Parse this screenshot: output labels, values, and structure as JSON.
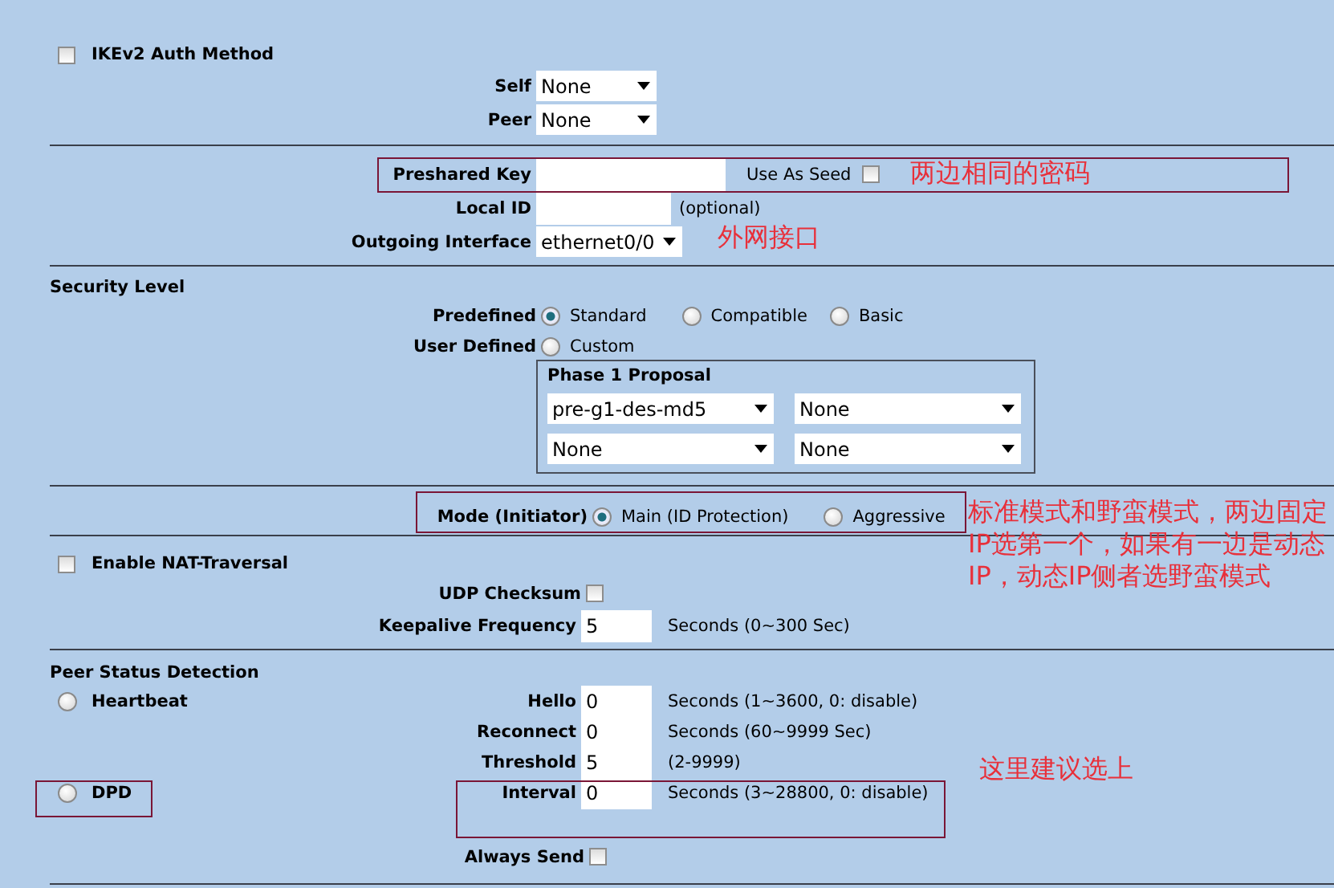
{
  "ike_auth": {
    "label": "IKEv2 Auth Method",
    "checked": false,
    "self": {
      "label": "Self",
      "value": "None"
    },
    "peer": {
      "label": "Peer",
      "value": "None"
    }
  },
  "preshared_key": {
    "label": "Preshared Key",
    "use_as_seed": {
      "label": "Use As Seed",
      "checked": false
    }
  },
  "local_id": {
    "label": "Local ID",
    "hint": "(optional)"
  },
  "outgoing_interface": {
    "label": "Outgoing Interface",
    "value": "ethernet0/0"
  },
  "security_level": {
    "title": "Security Level",
    "predefined": {
      "label": "Predefined",
      "options": [
        {
          "label": "Standard",
          "selected": true
        },
        {
          "label": "Compatible",
          "selected": false
        },
        {
          "label": "Basic",
          "selected": false
        }
      ]
    },
    "user_defined": {
      "label": "User Defined",
      "options": [
        {
          "label": "Custom",
          "selected": false
        }
      ]
    },
    "phase1": {
      "title": "Phase 1 Proposal",
      "values": [
        "pre-g1-des-md5",
        "None",
        "None",
        "None"
      ]
    }
  },
  "mode": {
    "label": "Mode (Initiator)",
    "options": [
      {
        "label": "Main (ID Protection)",
        "selected": true
      },
      {
        "label": "Aggressive",
        "selected": false
      }
    ]
  },
  "nat_traversal": {
    "label": "Enable NAT-Traversal",
    "checked": false,
    "udp_checksum": {
      "label": "UDP Checksum",
      "checked": false
    },
    "keepalive": {
      "label": "Keepalive Frequency",
      "value": "5",
      "hint": "Seconds (0~300 Sec)"
    }
  },
  "peer_status": {
    "title": "Peer Status Detection",
    "methods": [
      {
        "label": "Heartbeat",
        "selected": false
      },
      {
        "label": "DPD",
        "selected": false
      }
    ],
    "fields": [
      {
        "label": "Hello",
        "value": "0",
        "hint": "Seconds (1~3600, 0: disable)"
      },
      {
        "label": "Reconnect",
        "value": "0",
        "hint": "Seconds (60~9999 Sec)"
      },
      {
        "label": "Threshold",
        "value": "5",
        "hint": "(2-9999)"
      },
      {
        "label": "Interval",
        "value": "0",
        "hint": "Seconds (3~28800, 0: disable)"
      }
    ],
    "always_send": {
      "label": "Always Send",
      "checked": false
    }
  },
  "annotations": [
    {
      "text": "两边相同的密码"
    },
    {
      "text": "外网接口"
    },
    {
      "text": "标准模式和野蛮模式，两边固定IP选第一个，如果有一边是动态IP，动态IP侧者选野蛮模式"
    },
    {
      "text": "这里建议选上"
    }
  ]
}
